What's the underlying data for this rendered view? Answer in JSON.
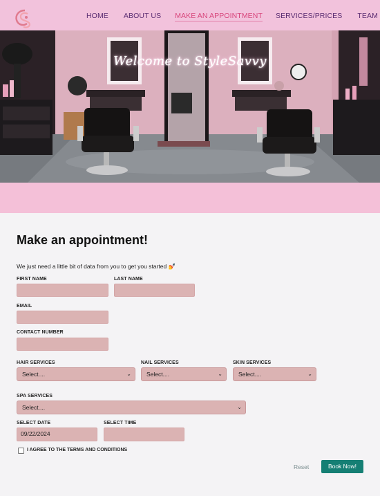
{
  "nav": {
    "items": [
      {
        "label": "HOME"
      },
      {
        "label": "ABOUT US"
      },
      {
        "label": "MAKE AN APPOINTMENT"
      },
      {
        "label": "SERVICES/PRICES"
      },
      {
        "label": "TEAM"
      }
    ],
    "active_index": 2
  },
  "hero": {
    "title": "Welcome to StyleSavvy"
  },
  "form": {
    "heading": "Make an appointment!",
    "intro": "We just need a little bit of data from you to get you started 💅",
    "first_name_label": "FIRST NAME",
    "first_name_value": "",
    "last_name_label": "LAST NAME",
    "last_name_value": "",
    "email_label": "EMAIL",
    "email_value": "",
    "contact_label": "CONTACT NUMBER",
    "contact_value": "",
    "hair_label": "HAIR SERVICES",
    "hair_value": "Select....",
    "nail_label": "NAIL SERVICES",
    "nail_value": "Select....",
    "skin_label": "SKIN SERVICES",
    "skin_value": "Select....",
    "spa_label": "SPA SERVICES",
    "spa_value": "Select....",
    "date_label": "SELECT DATE",
    "date_value": "09/22/2024",
    "time_label": "SELECT TIME",
    "time_value": "",
    "terms_label": "I AGREE TO THE TERMS AND CONDITIONS",
    "reset_label": "Reset",
    "submit_label": "Book Now!"
  },
  "colors": {
    "nav_bg": "#f2c2dc",
    "nav_text": "#5b2d72",
    "nav_active": "#d8467c",
    "field_bg": "#dbb3b3",
    "submit_bg": "#157f74"
  }
}
